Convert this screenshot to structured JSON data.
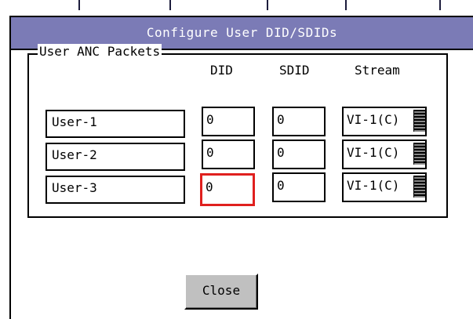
{
  "dialog": {
    "title": "Configure User DID/SDIDs",
    "group_label": "User ANC Packets",
    "columns": {
      "did": "DID",
      "sdid": "SDID",
      "stream": "Stream"
    },
    "rows": [
      {
        "name": "User-1",
        "did": "0",
        "sdid": "0",
        "stream": "VI-1(C)"
      },
      {
        "name": "User-2",
        "did": "0",
        "sdid": "0",
        "stream": "VI-1(C)"
      },
      {
        "name": "User-3",
        "did": "0",
        "sdid": "0",
        "stream": "VI-1(C)"
      }
    ],
    "close_label": "Close"
  },
  "colors": {
    "titlebar": "#7b7bb6",
    "focus": "#e0201e",
    "button": "#c0c0c0"
  }
}
